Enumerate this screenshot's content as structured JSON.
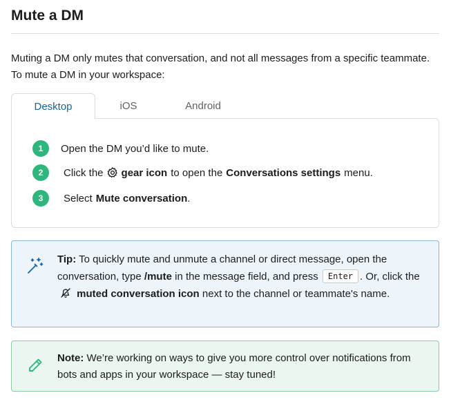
{
  "page": {
    "title": "Mute a DM",
    "intro": "Muting a DM only mutes that conversation, and not all messages from a specific teammate. To mute a DM in your workspace:"
  },
  "tabs": [
    {
      "label": "Desktop",
      "active": true
    },
    {
      "label": "iOS",
      "active": false
    },
    {
      "label": "Android",
      "active": false
    }
  ],
  "steps": {
    "s1": {
      "num": "1",
      "text": "Open the DM you’d like to mute."
    },
    "s2": {
      "num": "2",
      "pre": "Click the",
      "icon": "gear-icon",
      "bold1": "gear icon",
      "mid": "to open the",
      "bold2": "Conversations settings",
      "post": "menu."
    },
    "s3": {
      "num": "3",
      "pre": "Select",
      "bold": "Mute conversation",
      "post": "."
    }
  },
  "tip": {
    "icon": "sparkle-wand-icon",
    "label": "Tip:",
    "text1": "To quickly mute and unmute a channel or direct message, open the conversation, type",
    "command": "/mute",
    "text2": "in the message field, and press",
    "key": "Enter",
    "text3": ". Or, click the",
    "muted_icon": "muted-bell-icon",
    "bold": "muted conversation icon",
    "text4": "next to the channel or teammate's name."
  },
  "note": {
    "icon": "pencil-icon",
    "label": "Note:",
    "text": "We’re working on ways to give you more control over notifications from bots and apps in your workspace — stay tuned!"
  },
  "colors": {
    "accent": "#1264a3",
    "step_badge": "#2eb67d",
    "tip_bg": "#eef5fa",
    "tip_border": "#8ab4d4",
    "note_bg": "#eaf6ef",
    "note_border": "#8fcaa5"
  }
}
